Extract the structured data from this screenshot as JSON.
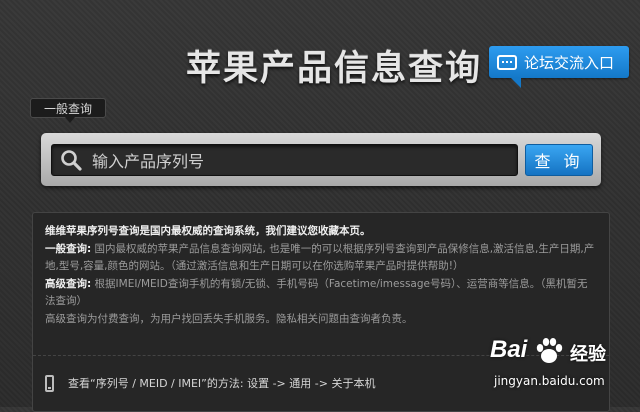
{
  "header": {
    "title": "苹果产品信息查询",
    "forum_button": "论坛交流入口"
  },
  "search": {
    "tab_label": "一般查询",
    "placeholder": "输入产品序列号",
    "button": "查 询"
  },
  "info": {
    "line1": "维维苹果序列号查询是国内最权威的查询系统，我们建议您收藏本页。",
    "general_label": "一般查询:",
    "general_text": "国内最权威的苹果产品信息查询网站, 也是唯一的可以根据序列号查询到产品保修信息,激活信息,生产日期,产地,型号,容量,颜色的网站。（通过激活信息和生产日期可以在你选购苹果产品时提供帮助!）",
    "advanced_label": "高级查询:",
    "advanced_text": "根据IMEI/MEID查询手机的有锁/无锁、手机号码（Facetime/imessage号码）、运营商等信息。（黑机暂无法查询）",
    "advanced_note": "高级查询为付费查询，为用户找回丢失手机服务。隐私相关问题由查询者负责。",
    "howto": "查看“序列号 / MEID / IMEI”的方法: 设置 -> 通用 -> 关于本机"
  },
  "watermark": {
    "logo": "Bai",
    "suffix": "经验",
    "url": "jingyan.baidu.com"
  },
  "colors": {
    "accent_blue": "#1f8ee0",
    "background": "#2f2f2f"
  }
}
